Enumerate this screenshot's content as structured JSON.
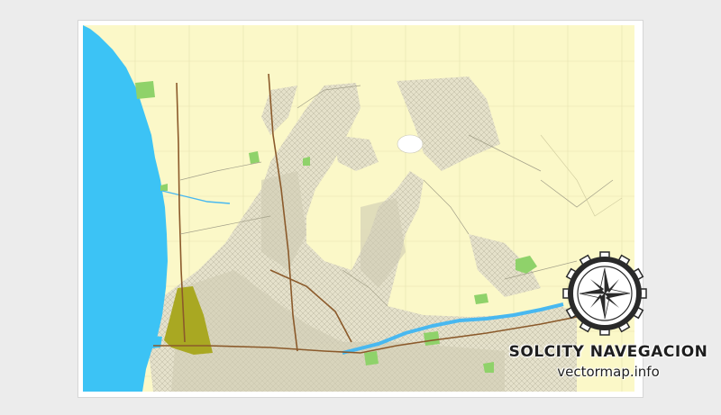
{
  "branding": {
    "company": "SOLCITY NAVEGACION",
    "website": "vectormap.info",
    "logo": "gear-compass-rose-logo"
  },
  "map": {
    "land_color": "#fbf8c8",
    "ocean_color": "#3cc3f5",
    "river_color": "#48b8f0",
    "park_color": "#8fd26a",
    "airport_color": "#a9a822",
    "urban_color": "#dedbc8",
    "major_road_color": "#8b5a2b"
  }
}
